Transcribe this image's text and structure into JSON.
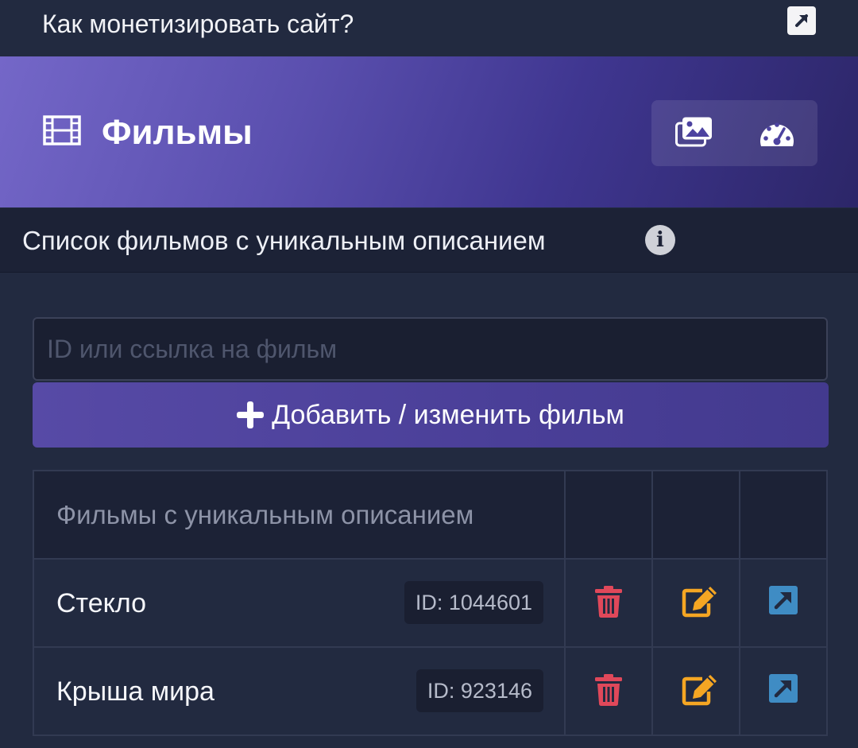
{
  "topbar": {
    "title": "Как монетизировать сайт?",
    "link_icon": "external-link-icon"
  },
  "hero": {
    "icon": "film-icon",
    "title": "Фильмы",
    "tools": [
      "gallery-icon",
      "dashboard-gauge-icon"
    ]
  },
  "section": {
    "title": "Список фильмов с уникальным описанием",
    "info_icon": "info-icon"
  },
  "search": {
    "placeholder": "ID или ссылка на фильм",
    "value": ""
  },
  "add_button": {
    "label": "Добавить / изменить фильм",
    "icon": "plus-icon"
  },
  "table": {
    "header": "Фильмы с уникальным описанием",
    "rows": [
      {
        "name": "Стекло",
        "id_badge": "ID: 1044601"
      },
      {
        "name": "Крыша мира",
        "id_badge": "ID: 923146"
      }
    ],
    "actions": [
      "trash-icon",
      "edit-icon",
      "open-link-icon"
    ]
  },
  "colors": {
    "background": "#222a40",
    "hero_gradient_start": "#7467c8",
    "hero_gradient_end": "#2c2668",
    "button": "#4d41a0",
    "delete": "#e0485a",
    "edit": "#f5a623",
    "open": "#3f8cc4"
  }
}
